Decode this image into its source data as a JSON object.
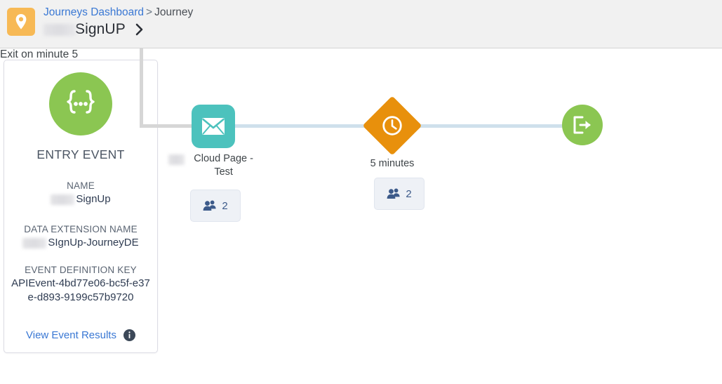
{
  "header": {
    "logo_icon": "location-pin-icon",
    "breadcrumb": {
      "link_label": "Journeys Dashboard",
      "separator": ">",
      "current_label": "Journey"
    },
    "journey_title": "SignUP",
    "journey_title_redacted": true,
    "chevron_icon": "chevron-right-icon"
  },
  "entry_card": {
    "icon": "curly-braces-ellipsis-icon",
    "heading": "ENTRY EVENT",
    "fields": [
      {
        "label": "NAME",
        "value": "SignUp",
        "redacted_prefix": true
      },
      {
        "label": "DATA EXTENSION NAME",
        "value": "SIgnUp-JourneyDE",
        "redacted_prefix": true
      },
      {
        "label": "EVENT DEFINITION KEY",
        "value": "APIEvent-4bd77e06-bc5f-e37e-d893-9199c57b9720",
        "redacted_prefix": false
      }
    ],
    "link_label": "View Event Results",
    "info_icon": "info-icon"
  },
  "flow": {
    "nodes": [
      {
        "id": "cloud-page",
        "type": "email",
        "icon": "envelope-icon",
        "label": "Cloud Page - Test",
        "redacted_prefix": true,
        "count": "2",
        "count_icon": "people-icon",
        "color": "#4cc2bd"
      },
      {
        "id": "wait",
        "type": "wait",
        "icon": "clock-icon",
        "label": "5 minutes",
        "redacted_prefix": false,
        "count": "2",
        "count_icon": "people-icon",
        "color": "#e8900c"
      },
      {
        "id": "exit",
        "type": "exit",
        "icon": "exit-arrow-icon",
        "label": "Exit on minute 5",
        "color": "#8bc652"
      }
    ],
    "connector_colors": {
      "entry_to_email": "#d6d6d6",
      "email_to_wait": "#cfe0ec",
      "wait_to_exit": "#cfe0ec"
    }
  },
  "colors": {
    "header_bg": "#f1f1f1",
    "brand_orange": "#f7b955",
    "green": "#8bc652",
    "teal": "#4cc2bd",
    "orange": "#e8900c",
    "link_blue": "#3a78d4"
  }
}
